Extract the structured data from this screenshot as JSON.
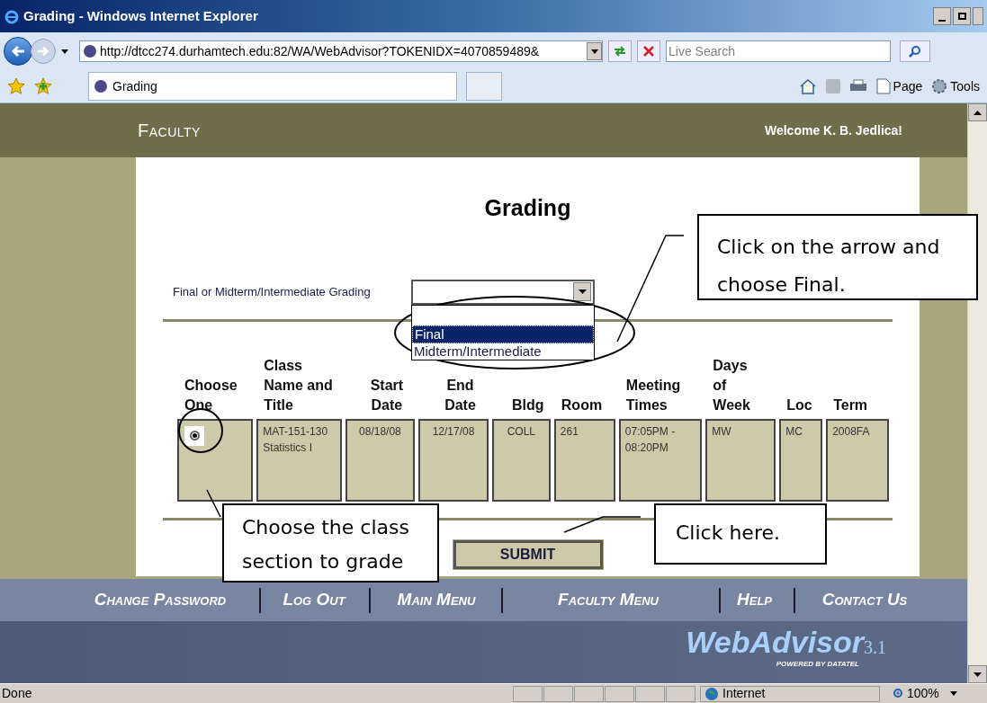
{
  "window": {
    "title": "Grading - Windows Internet Explorer"
  },
  "address_bar": {
    "url": "http://dtcc274.durhamtech.edu:82/WA/WebAdvisor?TOKENIDX=4070859489&",
    "search_placeholder": "Live Search"
  },
  "tabs": [
    {
      "label": "Grading",
      "selected": true
    }
  ],
  "command_bar": [
    {
      "label": "Page",
      "kind": "page"
    },
    {
      "label": "Tools",
      "kind": "tools"
    }
  ],
  "page_header": {
    "title": "Faculty",
    "welcome": "Welcome K. B. Jedlica!"
  },
  "heading": "Grading",
  "grading_type": {
    "label": "Final or Midterm/Intermediate Grading",
    "expanded": true,
    "options": [
      {
        "label": "Final",
        "selected": true
      },
      {
        "label": "Midterm/Intermediate",
        "selected": false
      }
    ]
  },
  "table": {
    "choose_column": "Choose One",
    "columns": [
      "Class Name and Title",
      "Start Date",
      "End Date",
      "Bldg",
      "Room",
      "Meeting Times",
      "Days of Week",
      "Loc",
      "Term"
    ],
    "rows": [
      {
        "checked": true,
        "cells": [
          "MAT-151-130 Statistics I",
          "08/18/08",
          "12/17/08",
          "COLL",
          "261",
          "07:05PM - 08:20PM",
          "MW",
          "MC",
          "2008FA"
        ]
      }
    ]
  },
  "submit": "SUBMIT",
  "footer_nav": [
    "Change Password",
    "Log Out",
    "Main Menu",
    "Faculty Menu",
    "Help",
    "Contact Us"
  ],
  "logo": {
    "name": "WebAdvisor",
    "version": "3.1",
    "tagline": "POWERED BY DATATEL"
  },
  "status_bar": {
    "status": "Done",
    "zone": "Internet",
    "zoom": "100%"
  },
  "callouts": [
    {
      "text": "Click on the arrow and choose Final.",
      "kind": "dropdown"
    },
    {
      "text": "Choose the class section to grade",
      "kind": "radio"
    },
    {
      "text": "Click here.",
      "kind": "submit"
    }
  ]
}
